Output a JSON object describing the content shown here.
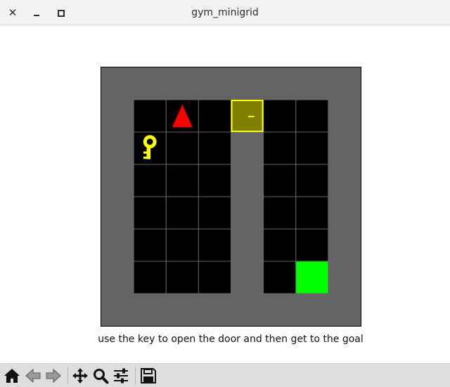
{
  "window": {
    "title": "gym_minigrid",
    "close_glyph": "✕"
  },
  "caption": "use the key to open the door and then get to the goal",
  "env": {
    "grid_width": 8,
    "grid_height": 8,
    "colors": {
      "background": "#646464",
      "floor": "#000000",
      "grid_line": "#646464",
      "agent": "#ff0000",
      "key": "#ffff00",
      "door_frame": "#ffff00",
      "door_fill": "#7f7f00",
      "goal": "#00ff00"
    },
    "floor_cells": [
      [
        1,
        1
      ],
      [
        2,
        1
      ],
      [
        3,
        1
      ],
      [
        5,
        1
      ],
      [
        6,
        1
      ],
      [
        1,
        2
      ],
      [
        2,
        2
      ],
      [
        3,
        2
      ],
      [
        5,
        2
      ],
      [
        6,
        2
      ],
      [
        1,
        3
      ],
      [
        2,
        3
      ],
      [
        3,
        3
      ],
      [
        5,
        3
      ],
      [
        6,
        3
      ],
      [
        1,
        4
      ],
      [
        2,
        4
      ],
      [
        3,
        4
      ],
      [
        5,
        4
      ],
      [
        6,
        4
      ],
      [
        1,
        5
      ],
      [
        2,
        5
      ],
      [
        3,
        5
      ],
      [
        5,
        5
      ],
      [
        6,
        5
      ],
      [
        1,
        6
      ],
      [
        2,
        6
      ],
      [
        3,
        6
      ],
      [
        5,
        6
      ]
    ],
    "door": {
      "cell": [
        4,
        1
      ],
      "state": "locked",
      "color": "yellow"
    },
    "key": {
      "cell": [
        1,
        2
      ],
      "color": "yellow"
    },
    "agent": {
      "cell": [
        2,
        1
      ],
      "direction": "up"
    },
    "goal": {
      "cell": [
        6,
        6
      ]
    }
  },
  "toolbar": {
    "tools": [
      {
        "name": "home-button",
        "icon": "home-icon"
      },
      {
        "name": "back-button",
        "icon": "arrow-left-icon"
      },
      {
        "name": "forward-button",
        "icon": "arrow-right-icon"
      },
      {
        "name": "pan-button",
        "icon": "move-icon"
      },
      {
        "name": "zoom-button",
        "icon": "magnifier-icon"
      },
      {
        "name": "configure-subplots-button",
        "icon": "sliders-icon"
      },
      {
        "name": "save-button",
        "icon": "floppy-disk-icon"
      }
    ]
  }
}
